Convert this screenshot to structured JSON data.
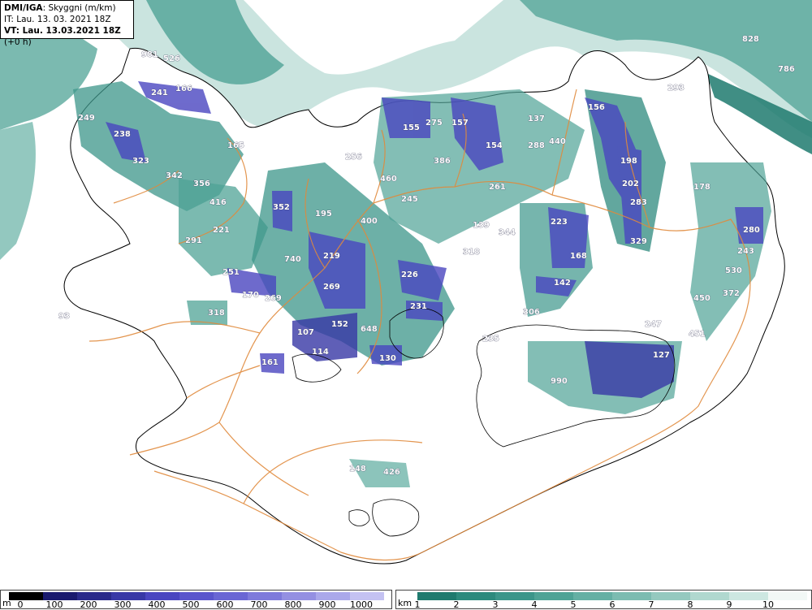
{
  "header": {
    "source": "DMI/IGA",
    "parameter": "Skyggni (m/km)",
    "initial_time": "IT: Lau. 13. 03. 2021 18Z",
    "valid_time": "VT: Lau. 13.03.2021 18Z",
    "lead_time": "(+0 h)"
  },
  "legend_meters": {
    "unit": "m",
    "labels": [
      "0",
      "100",
      "200",
      "300",
      "400",
      "500",
      "600",
      "700",
      "800",
      "900",
      "1000"
    ],
    "colors": [
      "#000000",
      "#1a1a6e",
      "#2a2a8a",
      "#3838a6",
      "#4a46c0",
      "#5a55cc",
      "#6a66d4",
      "#7e7adb",
      "#9490e2",
      "#aaa8ea",
      "#c4c2f2"
    ]
  },
  "legend_km": {
    "unit": "km",
    "labels": [
      "1",
      "2",
      "3",
      "4",
      "5",
      "6",
      "7",
      "8",
      "9",
      "10"
    ],
    "colors": [
      "#1f7a6e",
      "#2d8a7d",
      "#3c968a",
      "#4fa396",
      "#65b0a4",
      "#7cbcb1",
      "#95c9bf",
      "#b0d8cf",
      "#cde7e1",
      "#f2f8f6"
    ]
  },
  "colors": {
    "coast": "#000000",
    "roads": "#e08a3c",
    "fog_dark": "#1f7a6e",
    "fog_mid": "#4fa396",
    "fog_light": "#9fcdc4",
    "low_vis": "#4a46c0"
  },
  "values": [
    {
      "v": "981"
    },
    {
      "v": "526"
    },
    {
      "v": "241"
    },
    {
      "v": "166"
    },
    {
      "v": "249"
    },
    {
      "v": "238"
    },
    {
      "v": "323"
    },
    {
      "v": "165"
    },
    {
      "v": "342"
    },
    {
      "v": "356"
    },
    {
      "v": "416"
    },
    {
      "v": "291"
    },
    {
      "v": "221"
    },
    {
      "v": "251"
    },
    {
      "v": "170"
    },
    {
      "v": "269"
    },
    {
      "v": "318"
    },
    {
      "v": "93"
    },
    {
      "v": "161"
    },
    {
      "v": "107"
    },
    {
      "v": "114"
    },
    {
      "v": "152"
    },
    {
      "v": "648"
    },
    {
      "v": "130"
    },
    {
      "v": "231"
    },
    {
      "v": "226"
    },
    {
      "v": "269"
    },
    {
      "v": "219"
    },
    {
      "v": "740"
    },
    {
      "v": "352"
    },
    {
      "v": "195"
    },
    {
      "v": "400"
    },
    {
      "v": "256"
    },
    {
      "v": "460"
    },
    {
      "v": "245"
    },
    {
      "v": "155"
    },
    {
      "v": "275"
    },
    {
      "v": "157"
    },
    {
      "v": "154"
    },
    {
      "v": "386"
    },
    {
      "v": "261"
    },
    {
      "v": "139"
    },
    {
      "v": "318"
    },
    {
      "v": "344"
    },
    {
      "v": "137"
    },
    {
      "v": "288"
    },
    {
      "v": "440"
    },
    {
      "v": "156"
    },
    {
      "v": "198"
    },
    {
      "v": "202"
    },
    {
      "v": "283"
    },
    {
      "v": "329"
    },
    {
      "v": "223"
    },
    {
      "v": "168"
    },
    {
      "v": "142"
    },
    {
      "v": "306"
    },
    {
      "v": "235"
    },
    {
      "v": "990"
    },
    {
      "v": "127"
    },
    {
      "v": "247"
    },
    {
      "v": "451"
    },
    {
      "v": "450"
    },
    {
      "v": "372"
    },
    {
      "v": "530"
    },
    {
      "v": "243"
    },
    {
      "v": "280"
    },
    {
      "v": "178"
    },
    {
      "v": "293"
    },
    {
      "v": "828"
    },
    {
      "v": "786"
    },
    {
      "v": "148"
    },
    {
      "v": "426"
    }
  ]
}
